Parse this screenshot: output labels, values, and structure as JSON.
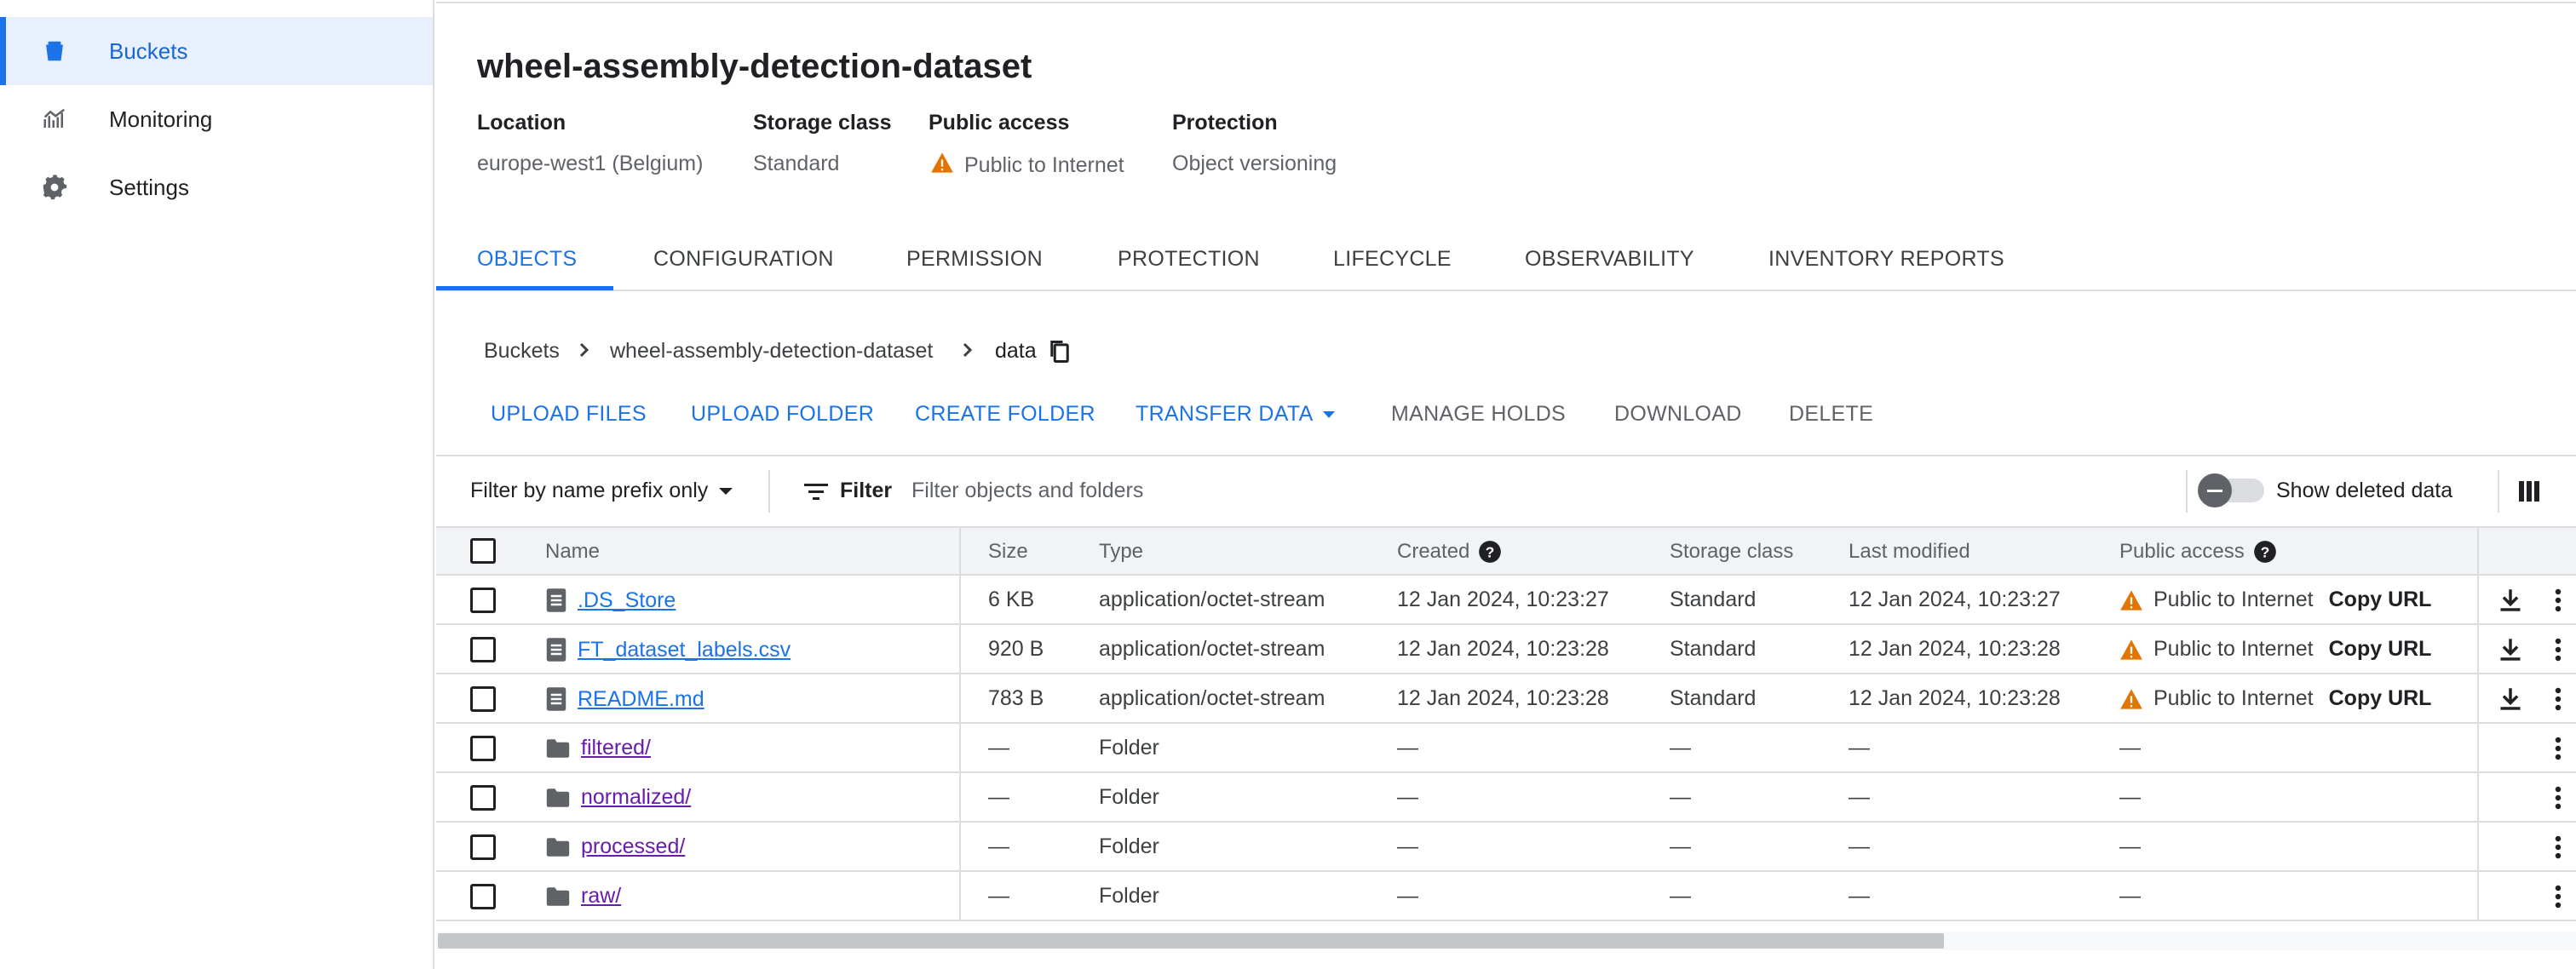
{
  "sidebar": {
    "items": [
      {
        "label": "Buckets",
        "icon": "bucket-icon",
        "active": true
      },
      {
        "label": "Monitoring",
        "icon": "chart-icon",
        "active": false
      },
      {
        "label": "Settings",
        "icon": "gear-icon",
        "active": false
      }
    ]
  },
  "bucket": {
    "title": "wheel-assembly-detection-dataset",
    "location_label": "Location",
    "location_value": "europe-west1 (Belgium)",
    "storage_class_label": "Storage class",
    "storage_class_value": "Standard",
    "public_access_label": "Public access",
    "public_access_value": "Public to Internet",
    "protection_label": "Protection",
    "protection_value": "Object versioning"
  },
  "tabs": [
    {
      "label": "OBJECTS",
      "active": true
    },
    {
      "label": "CONFIGURATION",
      "active": false
    },
    {
      "label": "PERMISSION",
      "active": false
    },
    {
      "label": "PROTECTION",
      "active": false
    },
    {
      "label": "LIFECYCLE",
      "active": false
    },
    {
      "label": "OBSERVABILITY",
      "active": false
    },
    {
      "label": "INVENTORY REPORTS",
      "active": false
    }
  ],
  "breadcrumb": {
    "root": "Buckets",
    "bucket": "wheel-assembly-detection-dataset",
    "current": "data"
  },
  "actions": {
    "upload_files": "UPLOAD FILES",
    "upload_folder": "UPLOAD FOLDER",
    "create_folder": "CREATE FOLDER",
    "transfer_data": "TRANSFER DATA",
    "manage_holds": "MANAGE HOLDS",
    "download": "DOWNLOAD",
    "delete": "DELETE"
  },
  "filter": {
    "mode": "Filter by name prefix only",
    "button": "Filter",
    "placeholder": "Filter objects and folders",
    "show_deleted": "Show deleted data"
  },
  "table": {
    "headers": {
      "name": "Name",
      "size": "Size",
      "type": "Type",
      "created": "Created",
      "storage_class": "Storage class",
      "last_modified": "Last modified",
      "public_access": "Public access"
    },
    "rows": [
      {
        "name": ".DS_Store",
        "kind": "file",
        "size": "6 KB",
        "type": "application/octet-stream",
        "created": "12 Jan 2024, 10:23:27",
        "storage_class": "Standard",
        "last_modified": "12 Jan 2024, 10:23:27",
        "public_access": "Public to Internet",
        "copy_url": "Copy URL"
      },
      {
        "name": "FT_dataset_labels.csv",
        "kind": "file",
        "size": "920 B",
        "type": "application/octet-stream",
        "created": "12 Jan 2024, 10:23:28",
        "storage_class": "Standard",
        "last_modified": "12 Jan 2024, 10:23:28",
        "public_access": "Public to Internet",
        "copy_url": "Copy URL"
      },
      {
        "name": "README.md",
        "kind": "file",
        "size": "783 B",
        "type": "application/octet-stream",
        "created": "12 Jan 2024, 10:23:28",
        "storage_class": "Standard",
        "last_modified": "12 Jan 2024, 10:23:28",
        "public_access": "Public to Internet",
        "copy_url": "Copy URL"
      },
      {
        "name": "filtered/",
        "kind": "folder",
        "size": "—",
        "type": "Folder",
        "created": "—",
        "storage_class": "—",
        "last_modified": "—",
        "public_access": "—"
      },
      {
        "name": "normalized/",
        "kind": "folder",
        "size": "—",
        "type": "Folder",
        "created": "—",
        "storage_class": "—",
        "last_modified": "—",
        "public_access": "—"
      },
      {
        "name": "processed/",
        "kind": "folder",
        "size": "—",
        "type": "Folder",
        "created": "—",
        "storage_class": "—",
        "last_modified": "—",
        "public_access": "—"
      },
      {
        "name": "raw/",
        "kind": "folder",
        "size": "—",
        "type": "Folder",
        "created": "—",
        "storage_class": "—",
        "last_modified": "—",
        "public_access": "—"
      }
    ]
  },
  "colors": {
    "accent": "#1a73e8",
    "warning": "#e37400",
    "visited_link": "#681da8"
  }
}
